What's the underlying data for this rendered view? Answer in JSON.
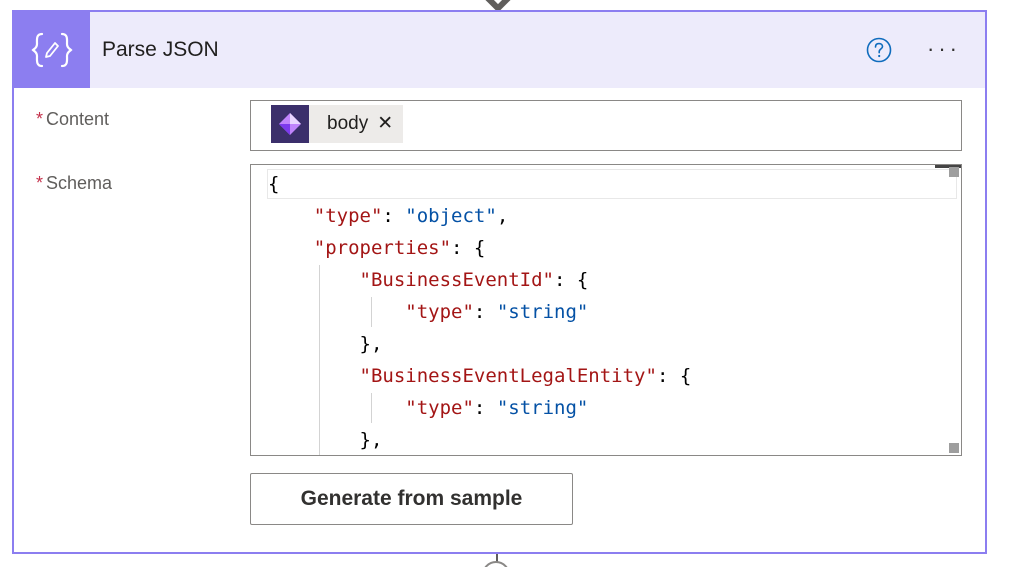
{
  "action": {
    "title": "Parse JSON",
    "help_icon": "help-circle-icon",
    "more_label": "···",
    "icon": "json-braces-icon"
  },
  "fields": {
    "content": {
      "required_mark": "*",
      "label": "Content",
      "token": {
        "label": "body",
        "remove_label": "✕",
        "icon": "power-apps-icon"
      }
    },
    "schema": {
      "required_mark": "*",
      "label": "Schema",
      "code_lines": [
        "{",
        "    \"type\": \"object\",",
        "    \"properties\": {",
        "        \"BusinessEventId\": {",
        "            \"type\": \"string\"",
        "        },",
        "        \"BusinessEventLegalEntity\": {",
        "            \"type\": \"string\"",
        "        },"
      ]
    }
  },
  "buttons": {
    "generate_label": "Generate from sample"
  },
  "colors": {
    "accent": "#8c7ef0",
    "header_bg": "#edebfb",
    "required": "#c4314b",
    "json_key": "#a31515",
    "json_value": "#0451a5"
  }
}
